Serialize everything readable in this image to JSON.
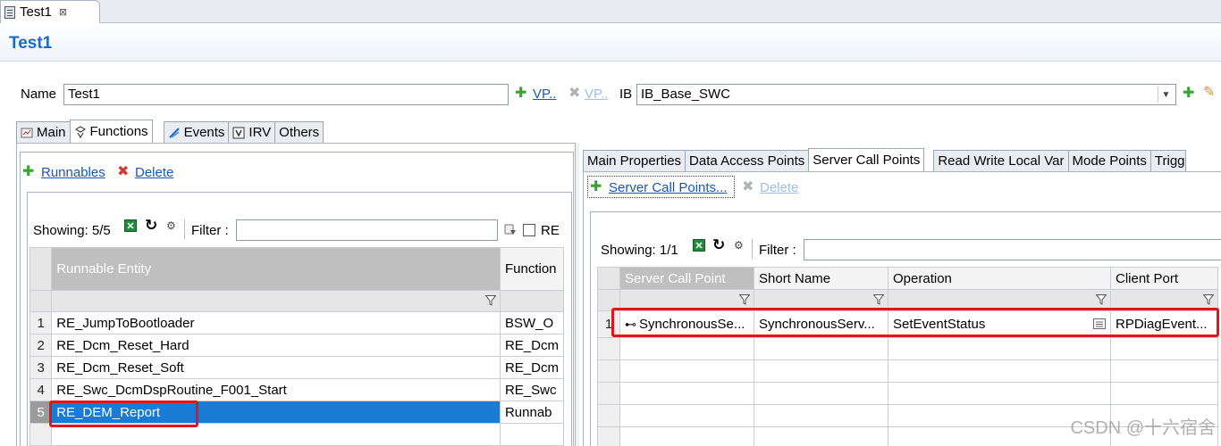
{
  "editor_tab": {
    "title": "Test1",
    "close": "⊠"
  },
  "form": {
    "title": "Test1"
  },
  "name_row": {
    "name_label": "Name",
    "name_value": "Test1",
    "vp_add": "VP..",
    "vp_remove": "VP..",
    "ib_label": "IB",
    "ib_value": "IB_Base_SWC"
  },
  "main_tabs": [
    "Main",
    "Functions",
    "Events",
    "IRV",
    "Others"
  ],
  "left": {
    "add_label": "Runnables",
    "delete_label": "Delete",
    "showing": "Showing: 5/5",
    "filter_label": "Filter :",
    "filter_value": "",
    "re_label": "RE",
    "columns": [
      "Runnable Entity",
      "Function"
    ],
    "rows": [
      {
        "n": "1",
        "name": "RE_JumpToBootloader",
        "func": "BSW_O"
      },
      {
        "n": "2",
        "name": "RE_Dcm_Reset_Hard",
        "func": "RE_Dcm"
      },
      {
        "n": "3",
        "name": "RE_Dcm_Reset_Soft",
        "func": "RE_Dcm"
      },
      {
        "n": "4",
        "name": "RE_Swc_DcmDspRoutine_F001_Start",
        "func": "RE_Swc"
      },
      {
        "n": "5",
        "name": "RE_DEM_Report",
        "func": "Runnab"
      }
    ]
  },
  "right": {
    "tabs": [
      "Main Properties",
      "Data Access Points",
      "Server Call Points",
      "Read Write Local Var",
      "Mode Points",
      "Trigg"
    ],
    "add_label": "Server Call Points...",
    "delete_label": "Delete",
    "showing": "Showing: 1/1",
    "filter_label": "Filter :",
    "filter_value": "",
    "columns": [
      "Server Call Point",
      "Short Name",
      "Operation",
      "Client Port"
    ],
    "rows": [
      {
        "n": "1",
        "scp": "SynchronousSe...",
        "short": "SynchronousServ...",
        "op": "SetEventStatus",
        "port": "RPDiagEvent..."
      }
    ]
  },
  "watermark": "CSDN @十六宿舍"
}
